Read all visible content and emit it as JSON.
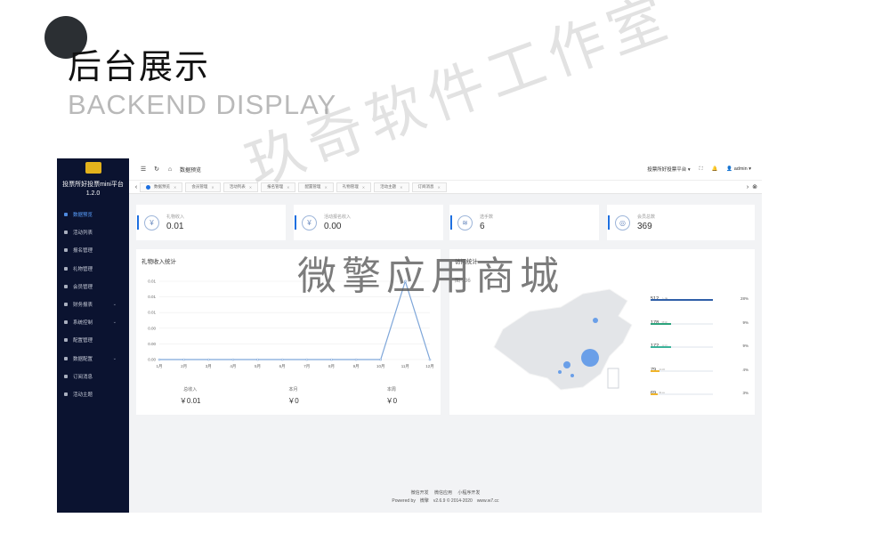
{
  "hero": {
    "title": "后台展示",
    "subtitle": "BACKEND DISPLAY"
  },
  "watermarks": {
    "diagonal": "玖奇软件工作室",
    "center": "微擎应用商城"
  },
  "sidebar": {
    "app_name": "投票所好投票mini平台",
    "version": "1.2.0",
    "items": [
      {
        "label": "数据预览",
        "icon": "home-icon",
        "active": true
      },
      {
        "label": "活动列表",
        "icon": "calendar-icon"
      },
      {
        "label": "报名管理",
        "icon": "pin-icon"
      },
      {
        "label": "礼物管理",
        "icon": "gift-icon"
      },
      {
        "label": "会员管理",
        "icon": "user-icon"
      },
      {
        "label": "财务报表",
        "icon": "wallet-icon",
        "expandable": true
      },
      {
        "label": "系统控制",
        "icon": "gear-icon",
        "expandable": true
      },
      {
        "label": "配置管理",
        "icon": "settings-icon"
      },
      {
        "label": "数据配置",
        "icon": "database-icon",
        "expandable": true
      },
      {
        "label": "订阅消息",
        "icon": "bell-icon"
      },
      {
        "label": "活动主题",
        "icon": "palette-icon"
      }
    ]
  },
  "topbar": {
    "breadcrumb": "数据预览",
    "platform": "投票所好投票平台",
    "user": "admin"
  },
  "tabs": [
    "数据预览",
    "会员管理",
    "活动列表",
    "报名管理",
    "配置管理",
    "礼物管理",
    "活动主题",
    "订阅消息"
  ],
  "stats": [
    {
      "label": "礼物收入",
      "value": "0.01",
      "icon": "yuan-icon"
    },
    {
      "label": "活动报名收入",
      "value": "0.00",
      "icon": "yuan-icon"
    },
    {
      "label": "选手数",
      "value": "6",
      "icon": "layers-icon"
    },
    {
      "label": "会员总数",
      "value": "369",
      "icon": "user-icon"
    }
  ],
  "gift_panel": {
    "title": "礼物收入统计",
    "totals": [
      {
        "label": "总收入",
        "value": "￥0.01"
      },
      {
        "label": "本月",
        "value": "￥0"
      },
      {
        "label": "本周",
        "value": "￥0"
      }
    ]
  },
  "chart_data": {
    "type": "line",
    "categories": [
      "1月",
      "2月",
      "3月",
      "4月",
      "5月",
      "6月",
      "7月",
      "8月",
      "9月",
      "10月",
      "11月",
      "12月"
    ],
    "values": [
      0,
      0,
      0,
      0,
      0,
      0,
      0,
      0,
      0,
      0,
      0.01,
      0
    ],
    "y_ticks": [
      "0.00",
      "0.00",
      "0.00",
      "0.01",
      "0.01",
      "0.01"
    ],
    "ylim": [
      0,
      0.01
    ],
    "line_color": "#7ea6d9"
  },
  "visit_panel": {
    "title": "访问统计",
    "subtitle": "图 : 36",
    "rank": [
      {
        "count": "512",
        "place": "上海",
        "pct": "28%",
        "frac": 0.28,
        "color": "#2f5fa8"
      },
      {
        "count": "178",
        "place": "重庆",
        "pct": "9%",
        "frac": 0.09,
        "color": "#2ba37c"
      },
      {
        "count": "172",
        "place": "北京",
        "pct": "9%",
        "frac": 0.09,
        "color": "#3bb39a"
      },
      {
        "count": "79",
        "place": "深圳",
        "pct": "4%",
        "frac": 0.04,
        "color": "#f0b429"
      },
      {
        "count": "69",
        "place": "贵州",
        "pct": "3%",
        "frac": 0.03,
        "color": "#f0b429"
      }
    ]
  },
  "footer": {
    "links": "微信开发　 微信应用　 小程序开发",
    "copyright": "Powered by　微擎　v2.6.9 © 2014-2020　www.w7.cc"
  }
}
